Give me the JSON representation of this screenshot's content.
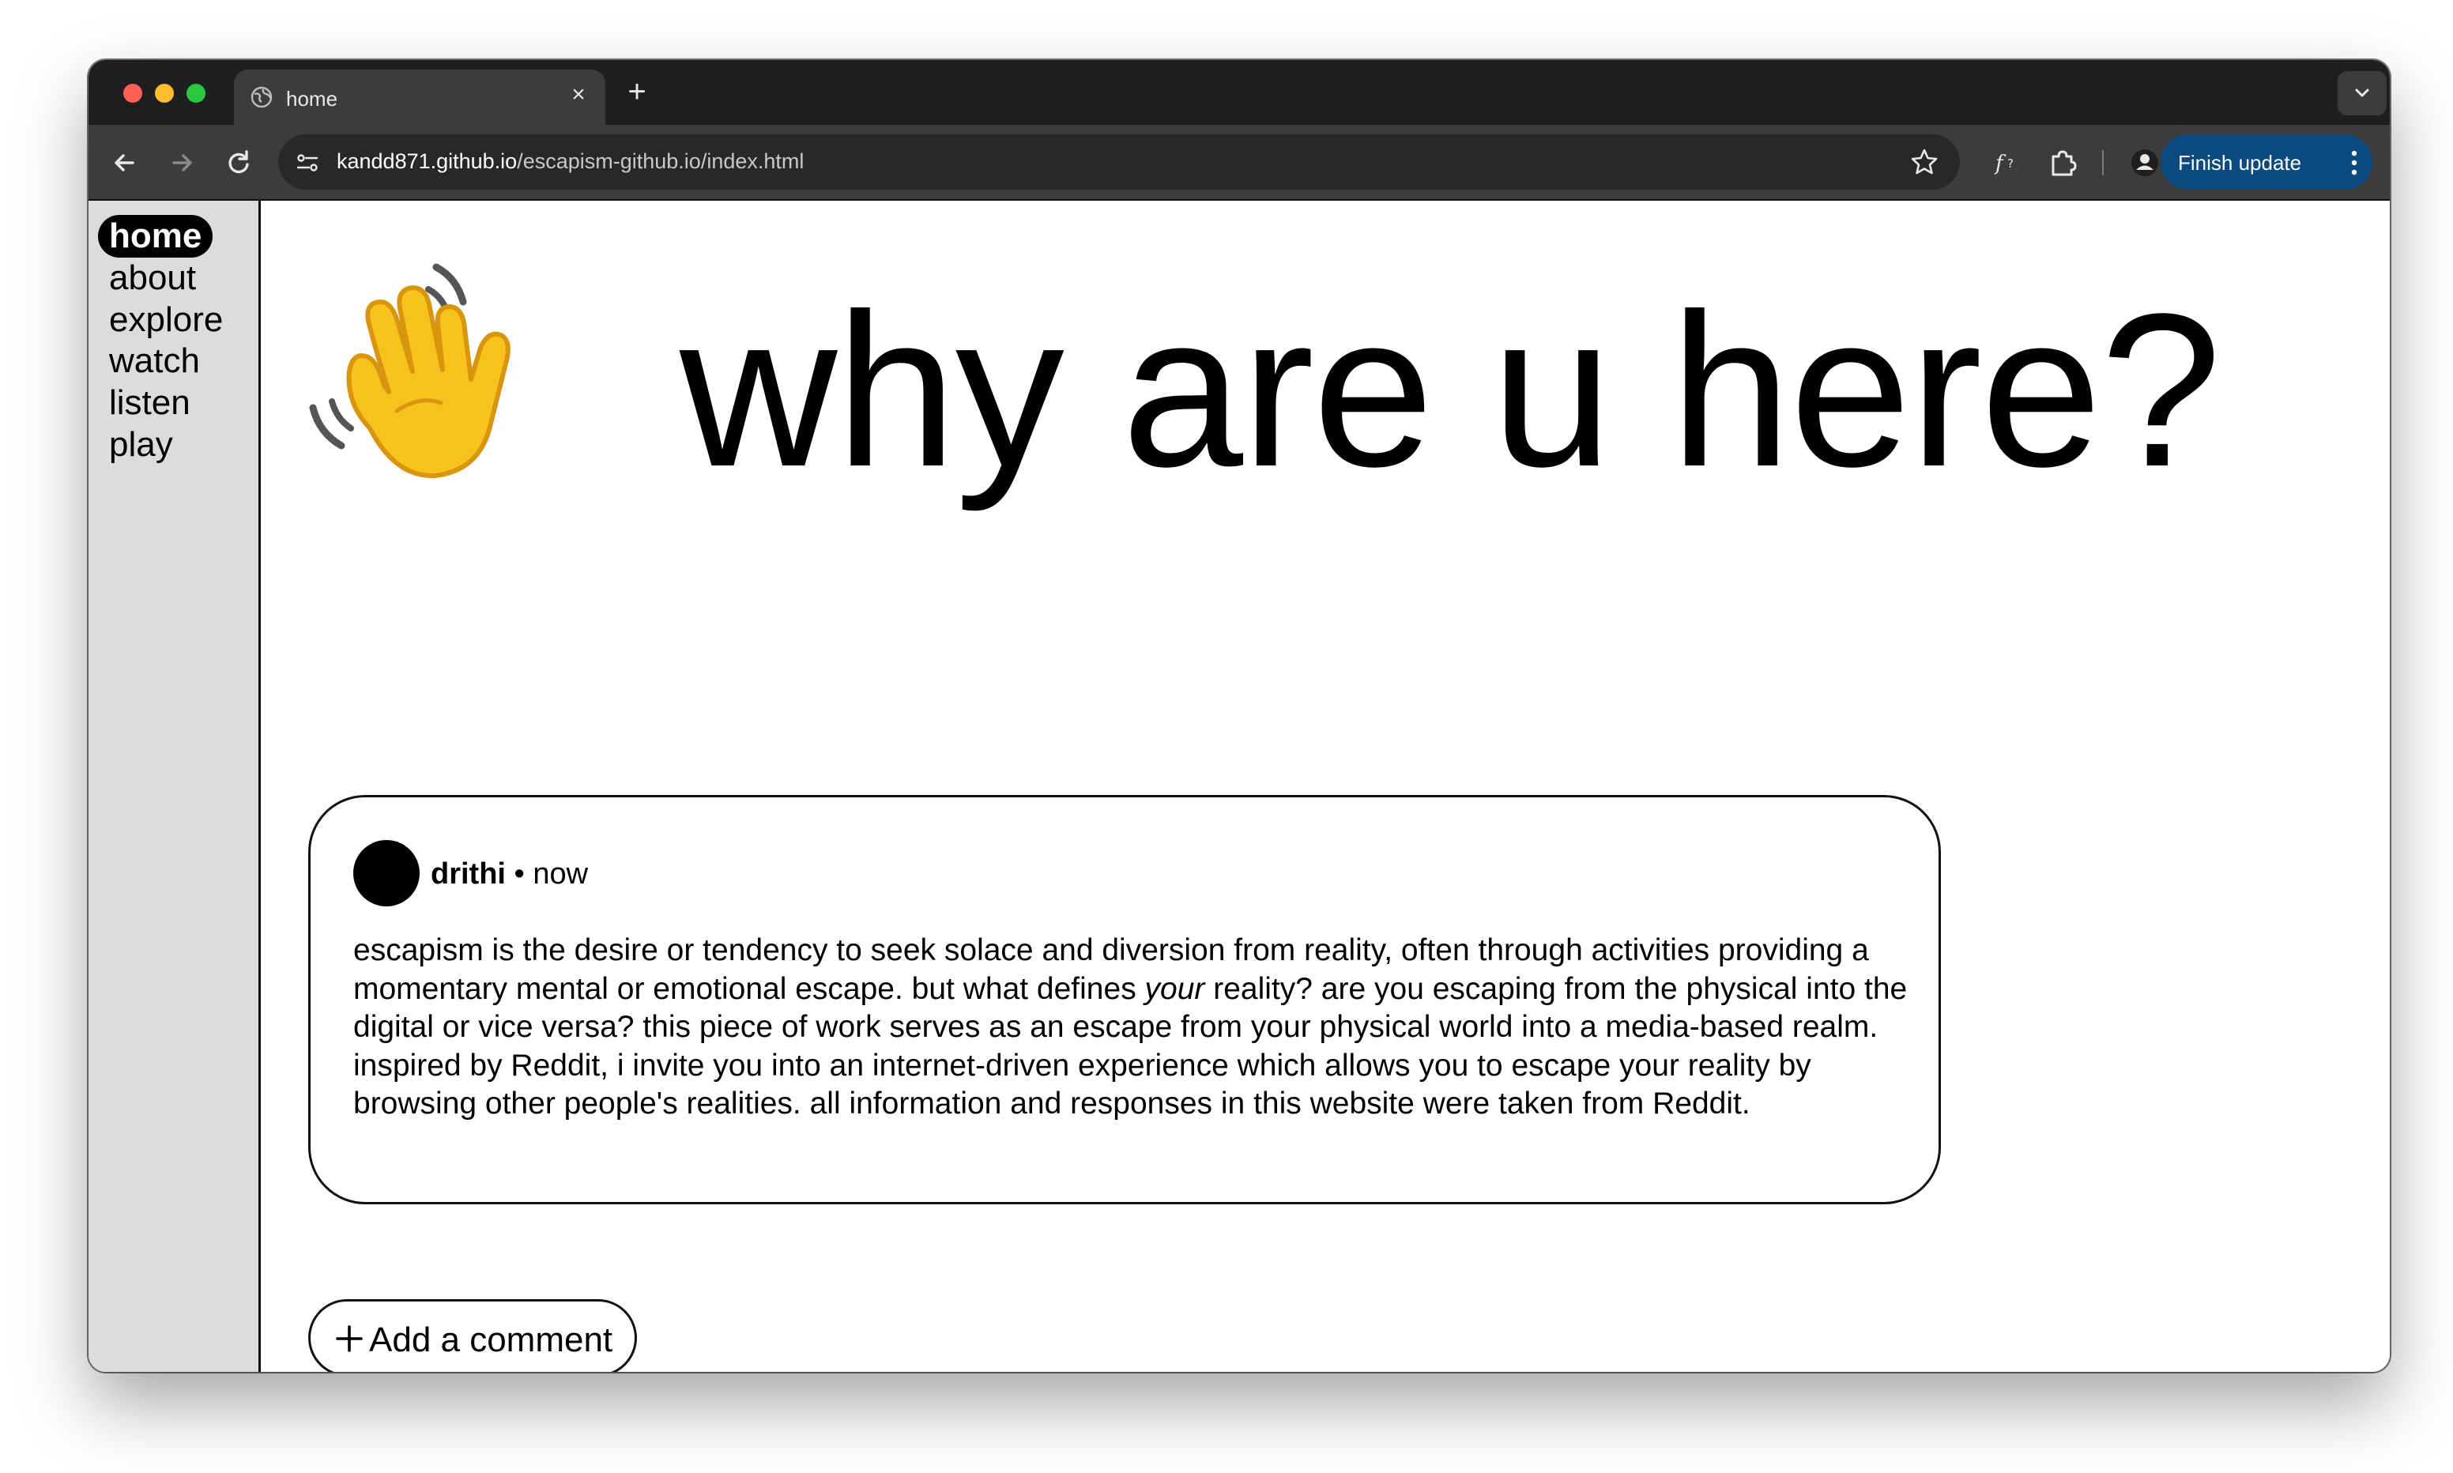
{
  "browser": {
    "tab_title": "home",
    "tab_close": "×",
    "new_tab": "+",
    "url_host": "kandd871.github.io",
    "url_path": "/escapism-github.io/index.html",
    "finish_update_label": "Finish update",
    "update_button_color": "#0a4a80"
  },
  "sidebar": {
    "items": [
      {
        "label": "home",
        "active": true
      },
      {
        "label": "about"
      },
      {
        "label": "explore"
      },
      {
        "label": "watch"
      },
      {
        "label": "listen"
      },
      {
        "label": "play"
      }
    ]
  },
  "hero": {
    "emoji_name": "waving-hand-icon",
    "headline": "why are u here?"
  },
  "post": {
    "username": "drithi",
    "separator": " • ",
    "time": "now",
    "body_part1": "escapism is the desire or tendency to seek solace and diversion from reality, often through activities providing a momentary mental or emotional escape. but what defines ",
    "body_emphasis": "your",
    "body_part2": " reality? are you escaping from the physical into the digital or vice versa? this piece of work serves as an escape from your physical world into a media-based realm. inspired by Reddit, i invite you into an internet-driven experience which allows you to escape your reality by browsing other people's realities. all information and responses in this website were taken from Reddit."
  },
  "comment_button": {
    "label": "Add a comment"
  }
}
